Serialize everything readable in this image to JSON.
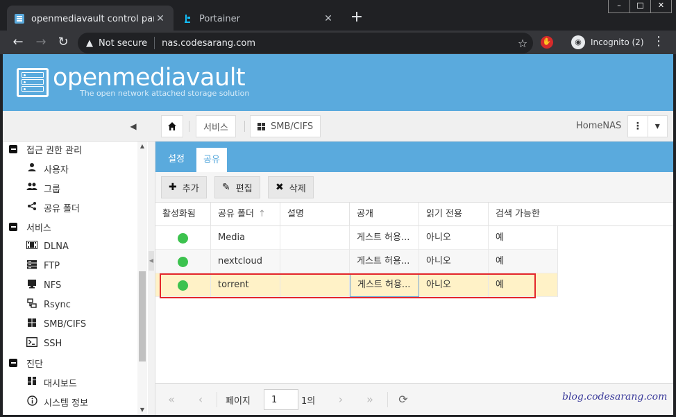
{
  "browser": {
    "tabs": [
      {
        "title": "openmediavault control panel - h",
        "active": true
      },
      {
        "title": "Portainer",
        "active": false
      }
    ],
    "new_tab": "+",
    "window_controls": [
      "–",
      "□",
      "✕"
    ],
    "security_label": "Not secure",
    "url": "nas.codesarang.com",
    "profile_label": "Incognito (2)",
    "colors": {
      "chrome_dark": "#202124",
      "chrome_toolbar": "#35363a"
    }
  },
  "app": {
    "brand": "openmediavault",
    "tagline": "The open network attached storage solution",
    "breadcrumb": {
      "home_icon": "home-icon",
      "items": [
        "서비스",
        "SMB/CIFS"
      ]
    },
    "hostname": "HomeNAS",
    "colors": {
      "header": "#5aaadd",
      "status_on": "#3cc24e",
      "selected_row": "#fff2c7",
      "highlight_box": "#e4262b"
    }
  },
  "sidebar": {
    "items": [
      {
        "label": "접근 권한 관리",
        "icon": "minus-square-icon",
        "level": "group"
      },
      {
        "label": "사용자",
        "icon": "user-icon",
        "level": "sub"
      },
      {
        "label": "그룹",
        "icon": "users-icon",
        "level": "sub"
      },
      {
        "label": "공유 폴더",
        "icon": "share-icon",
        "level": "sub"
      },
      {
        "label": "서비스",
        "icon": "minus-square-icon",
        "level": "group"
      },
      {
        "label": "DLNA",
        "icon": "film-icon",
        "level": "sub"
      },
      {
        "label": "FTP",
        "icon": "server-icon",
        "level": "sub"
      },
      {
        "label": "NFS",
        "icon": "desktop-icon",
        "level": "sub"
      },
      {
        "label": "Rsync",
        "icon": "sitemap-icon",
        "level": "sub"
      },
      {
        "label": "SMB/CIFS",
        "icon": "windows-icon",
        "level": "sub"
      },
      {
        "label": "SSH",
        "icon": "terminal-icon",
        "level": "sub"
      },
      {
        "label": "진단",
        "icon": "minus-square-icon",
        "level": "group"
      },
      {
        "label": "대시보드",
        "icon": "dashboard-icon",
        "level": "sub"
      },
      {
        "label": "시스템 정보",
        "icon": "info-icon",
        "level": "sub"
      }
    ]
  },
  "panel": {
    "tabs": [
      "설정",
      "공유"
    ],
    "active_tab": "공유",
    "actions": {
      "add": "추가",
      "edit": "편집",
      "delete": "삭제"
    },
    "columns": [
      "활성화됨",
      "공유 폴더",
      "설명",
      "공개",
      "읽기 전용",
      "검색 가능한"
    ],
    "sorted_column": "공유 폴더",
    "rows": [
      {
        "enabled": true,
        "folder": "Media",
        "description": "",
        "public": "게스트 허용...",
        "readonly": "아니오",
        "browsable": "예"
      },
      {
        "enabled": true,
        "folder": "nextcloud",
        "description": "",
        "public": "게스트 허용...",
        "readonly": "아니오",
        "browsable": "예"
      },
      {
        "enabled": true,
        "folder": "torrent",
        "description": "",
        "public": "게스트 허용...",
        "readonly": "아니오",
        "browsable": "예",
        "selected": true
      }
    ],
    "pager": {
      "page_label": "페이지",
      "page_value": "1",
      "of_label": "1의"
    }
  },
  "watermark": "blog.codesarang.com"
}
